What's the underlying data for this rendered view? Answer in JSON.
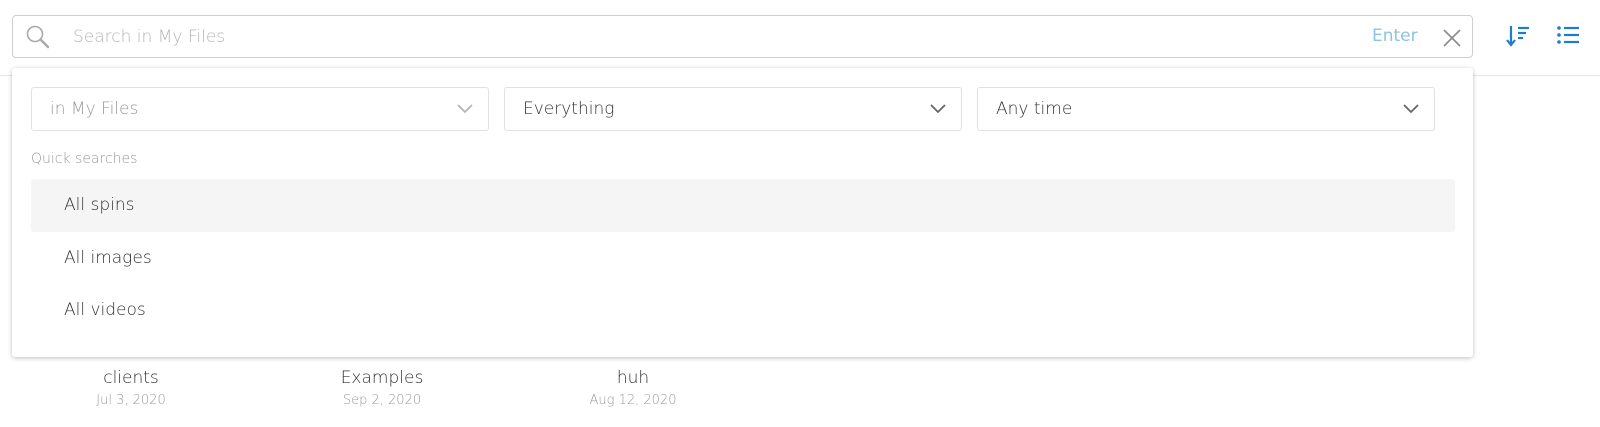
{
  "search": {
    "placeholder": "Search in My Files",
    "value": "",
    "enter_label": "Enter"
  },
  "toolbar": {
    "sort_icon": "sort-descending-icon",
    "list_icon": "list-view-icon",
    "accent_color": "#1f7ccc"
  },
  "filters": {
    "location": "in My Files",
    "type": "Everything",
    "time": "Any time"
  },
  "quick_searches": {
    "header": "Quick searches",
    "items": [
      {
        "label": "All spins"
      },
      {
        "label": "All images"
      },
      {
        "label": "All videos"
      }
    ]
  },
  "folders": [
    {
      "name": "clients",
      "date": "Jul 3, 2020"
    },
    {
      "name": "Examples",
      "date": "Sep 2, 2020"
    },
    {
      "name": "huh",
      "date": "Aug 12, 2020"
    }
  ]
}
